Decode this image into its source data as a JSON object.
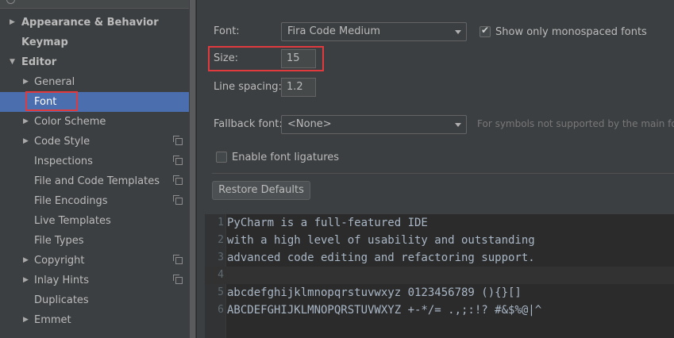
{
  "sidebar": {
    "items": [
      {
        "label": "Appearance & Behavior",
        "level": 0,
        "arrow": "right",
        "bold": true
      },
      {
        "label": "Keymap",
        "level": 0,
        "arrow": "none",
        "bold": true
      },
      {
        "label": "Editor",
        "level": 0,
        "arrow": "down",
        "bold": true
      },
      {
        "label": "General",
        "level": 1,
        "arrow": "right"
      },
      {
        "label": "Font",
        "level": 1,
        "arrow": "none",
        "selected": true
      },
      {
        "label": "Color Scheme",
        "level": 1,
        "arrow": "right"
      },
      {
        "label": "Code Style",
        "level": 1,
        "arrow": "right",
        "project_icon": true
      },
      {
        "label": "Inspections",
        "level": 1,
        "arrow": "none",
        "project_icon": true
      },
      {
        "label": "File and Code Templates",
        "level": 1,
        "arrow": "none",
        "project_icon": true
      },
      {
        "label": "File Encodings",
        "level": 1,
        "arrow": "none",
        "project_icon": true
      },
      {
        "label": "Live Templates",
        "level": 1,
        "arrow": "none"
      },
      {
        "label": "File Types",
        "level": 1,
        "arrow": "none"
      },
      {
        "label": "Copyright",
        "level": 1,
        "arrow": "right",
        "project_icon": true
      },
      {
        "label": "Inlay Hints",
        "level": 1,
        "arrow": "right",
        "project_icon": true
      },
      {
        "label": "Duplicates",
        "level": 1,
        "arrow": "none"
      },
      {
        "label": "Emmet",
        "level": 1,
        "arrow": "right"
      }
    ]
  },
  "font": {
    "label": "Font:",
    "value": "Fira Code Medium",
    "monospaced_label": "Show only monospaced fonts",
    "monospaced_checked": true
  },
  "size": {
    "label": "Size:",
    "value": "15"
  },
  "line_spacing": {
    "label": "Line spacing:",
    "value": "1.2"
  },
  "fallback": {
    "label": "Fallback font:",
    "value": "<None>",
    "hint": "For symbols not supported by the main fo"
  },
  "ligatures": {
    "label": "Enable font ligatures",
    "checked": false
  },
  "restore_label": "Restore Defaults",
  "preview": {
    "lines": [
      {
        "num": "1",
        "text": "PyCharm is a full-featured IDE"
      },
      {
        "num": "2",
        "text": "with a high level of usability and outstanding"
      },
      {
        "num": "3",
        "text": "advanced code editing and refactoring support."
      },
      {
        "num": "4",
        "text": "",
        "current": true
      },
      {
        "num": "5",
        "text": "abcdefghijklmnopqrstuvwxyz 0123456789 (){}[]"
      },
      {
        "num": "6",
        "text": "ABCDEFGHIJKLMNOPQRSTUVWXYZ +-*/= .,;:!? #&$%@|^"
      }
    ]
  },
  "colors": {
    "background": "#3c3f41",
    "selection": "#4b6eaf",
    "highlight_border": "#e0393e",
    "editor_background": "#2b2b2b",
    "editor_text": "#a9b7c6"
  }
}
